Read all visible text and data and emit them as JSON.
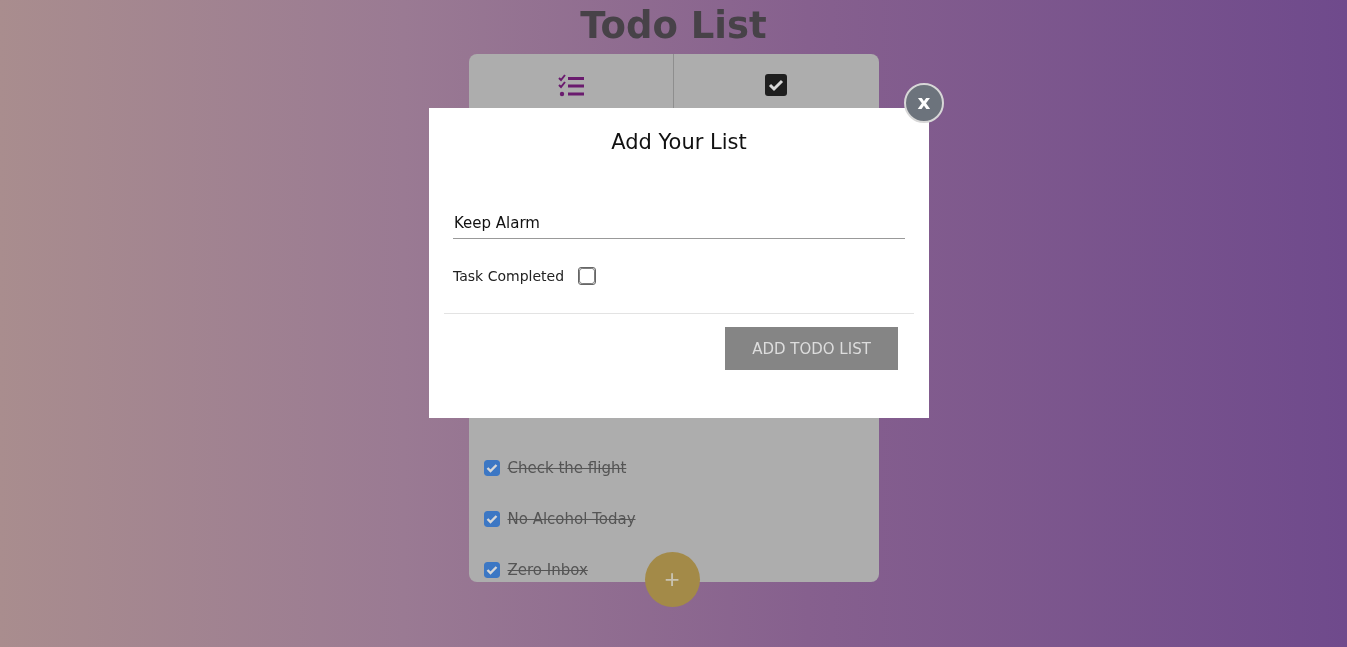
{
  "title": "Todo List",
  "tabs": [
    {
      "kind": "list",
      "selected": true
    },
    {
      "kind": "done",
      "selected": false
    }
  ],
  "todos": [
    {
      "text": "Check the flight",
      "checked": true
    },
    {
      "text": "No Alcohol Today",
      "checked": true
    },
    {
      "text": "Zero Inbox",
      "checked": true
    }
  ],
  "add_button": "+",
  "dialog": {
    "title": "Add Your List",
    "close": "x",
    "input": {
      "value": "Keep Alarm"
    },
    "completed": {
      "label": "Task Completed",
      "checked": false
    },
    "submit": "ADD TODO LIST"
  }
}
